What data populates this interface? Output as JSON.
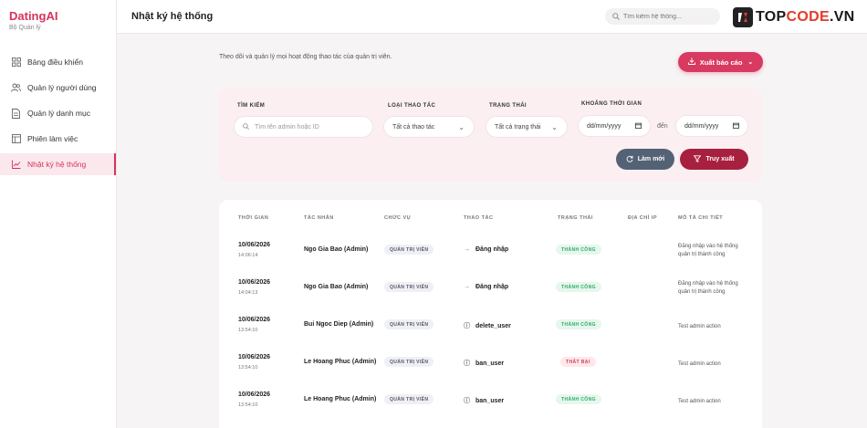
{
  "sidebar": {
    "brand": "DatingAI",
    "subtitle": "Bộ Quản lý",
    "items": [
      {
        "label": "Bảng điều khiển",
        "icon": "grid-icon",
        "active": false
      },
      {
        "label": "Quản lý người dùng",
        "icon": "users-icon",
        "active": false
      },
      {
        "label": "Quản lý danh mục",
        "icon": "document-icon",
        "active": false
      },
      {
        "label": "Phiên làm việc",
        "icon": "window-icon",
        "active": false
      },
      {
        "label": "Nhật ký hệ thống",
        "icon": "chart-line-icon",
        "active": true
      }
    ]
  },
  "header": {
    "title": "Nhật ký hệ thống",
    "search_placeholder": "Tìm kiếm hệ thống...",
    "logo_text_a": "TOP",
    "logo_text_b": "CODE",
    "logo_text_c": ".VN"
  },
  "main": {
    "description": "Theo dõi và quản lý mọi hoạt động thao tác của quản trị viên.",
    "export_label": "Xuất báo cáo"
  },
  "filters": {
    "search_label": "TÌM KIẾM",
    "search_placeholder": "Tìm tên admin hoặc ID",
    "type_label": "LOẠI THAO TÁC",
    "type_value": "Tất cả thao tác",
    "status_label": "TRẠNG THÁI",
    "status_value": "Tất cả trạng thái",
    "time_label": "KHOẢNG THỜI GIAN",
    "date_from": "dd/mm/yyyy",
    "to_label": "đến",
    "date_to": "dd/mm/yyyy",
    "reset_label": "Làm mới",
    "query_label": "Truy xuất"
  },
  "table": {
    "headers": [
      "THỜI GIAN",
      "TÁC NHÂN",
      "CHỨC VỤ",
      "THAO TÁC",
      "TRẠNG THÁI",
      "ĐỊA CHỈ IP",
      "MÔ TẢ CHI TIẾT"
    ],
    "rows": [
      {
        "date": "10/06/2026",
        "time": "14:06:14",
        "actor": "Ngo Gia Bao (Admin)",
        "role": "QUẢN TRỊ VIÊN",
        "action": "Đăng nhập",
        "action_icon": "login-icon",
        "status": "THÀNH CÔNG",
        "ok": true,
        "ip": "",
        "detail": "Đăng nhập vào hệ thống quản trị thành công"
      },
      {
        "date": "10/06/2026",
        "time": "14:04:13",
        "actor": "Ngo Gia Bao (Admin)",
        "role": "QUẢN TRỊ VIÊN",
        "action": "Đăng nhập",
        "action_icon": "login-icon",
        "status": "THÀNH CÔNG",
        "ok": true,
        "ip": "",
        "detail": "Đăng nhập vào hệ thống quản trị thành công"
      },
      {
        "date": "10/06/2026",
        "time": "13:54:10",
        "actor": "Bui Ngoc Diep (Admin)",
        "role": "QUẢN TRỊ VIÊN",
        "action": "delete_user",
        "action_icon": "info-icon",
        "status": "THÀNH CÔNG",
        "ok": true,
        "ip": "",
        "detail": "Test admin action"
      },
      {
        "date": "10/06/2026",
        "time": "13:54:10",
        "actor": "Le Hoang Phuc (Admin)",
        "role": "QUẢN TRỊ VIÊN",
        "action": "ban_user",
        "action_icon": "info-icon",
        "status": "THẤT BẠI",
        "ok": false,
        "ip": "",
        "detail": "Test admin action"
      },
      {
        "date": "10/06/2026",
        "time": "13:54:10",
        "actor": "Le Hoang Phuc (Admin)",
        "role": "QUẢN TRỊ VIÊN",
        "action": "ban_user",
        "action_icon": "info-icon",
        "status": "THÀNH CÔNG",
        "ok": true,
        "ip": "",
        "detail": "Test admin action"
      }
    ]
  },
  "colors": {
    "accent": "#d93a62",
    "accent_dark": "#a8203f",
    "success": "#2fa866",
    "danger": "#d33a5a"
  }
}
